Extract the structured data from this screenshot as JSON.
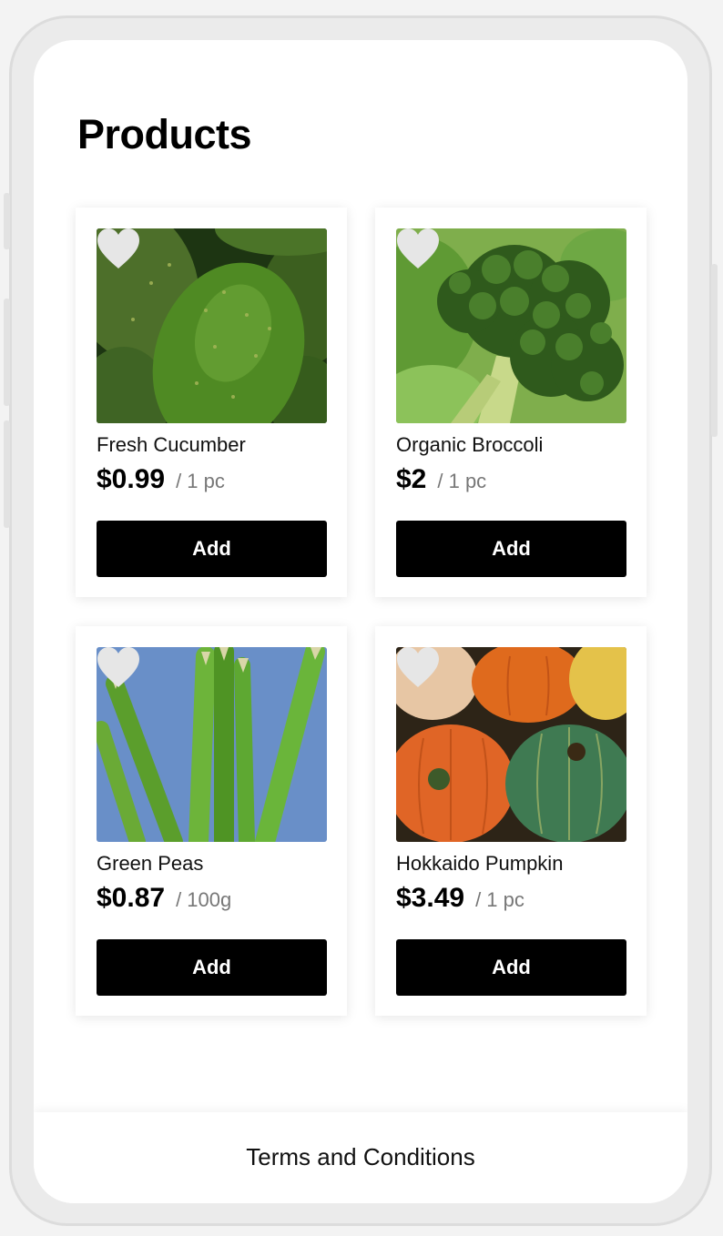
{
  "page": {
    "title": "Products"
  },
  "products": [
    {
      "name": "Fresh Cucumber",
      "price": "$0.99",
      "unit": "/ 1 pc",
      "add_label": "Add",
      "image": "cucumber-photo",
      "favorite": false
    },
    {
      "name": "Organic Broccoli",
      "price": "$2",
      "unit": "/ 1 pc",
      "add_label": "Add",
      "image": "broccoli-photo",
      "favorite": false
    },
    {
      "name": "Green Peas",
      "price": "$0.87",
      "unit": "/ 100g",
      "add_label": "Add",
      "image": "asparagus-photo",
      "favorite": false
    },
    {
      "name": "Hokkaido Pumpkin",
      "price": "$3.49",
      "unit": "/ 1 pc",
      "add_label": "Add",
      "image": "pumpkin-photo",
      "favorite": false
    }
  ],
  "footer": {
    "terms_label": "Terms and Conditions"
  },
  "colors": {
    "button_bg": "#000000",
    "button_text": "#ffffff",
    "heart": "#e6e6e6",
    "unit_text": "#777777"
  }
}
